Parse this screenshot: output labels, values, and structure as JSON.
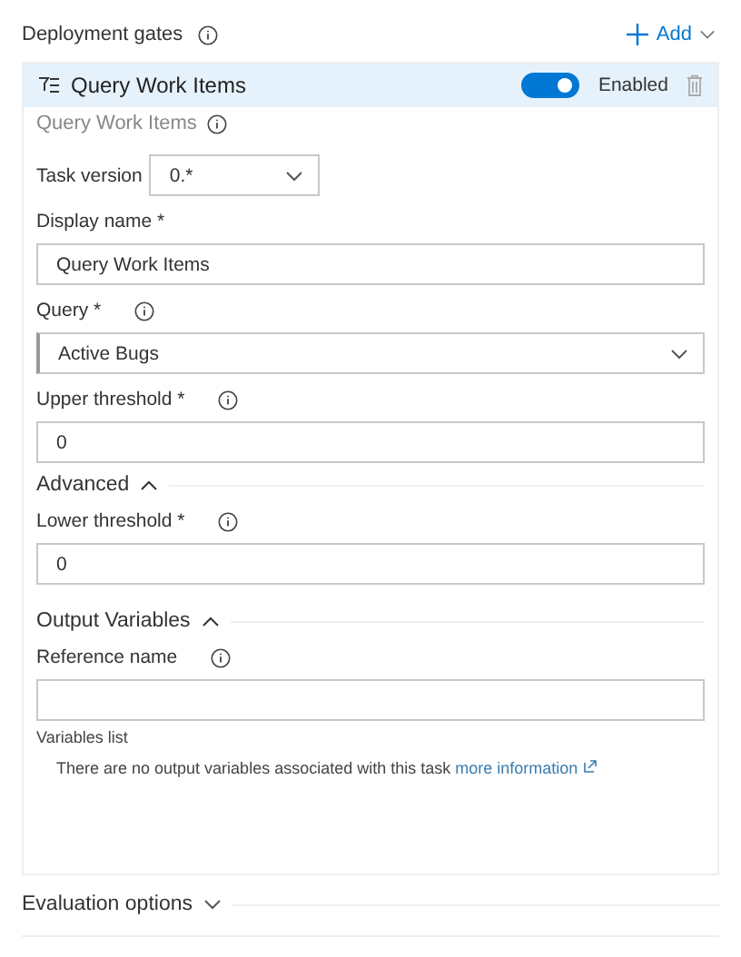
{
  "header": {
    "title": "Deployment gates",
    "add_label": "Add"
  },
  "gate": {
    "name": "Query Work Items",
    "enabled": true,
    "enabled_label": "Enabled",
    "subtitle": "Query Work Items"
  },
  "form": [
    {
      "kind": "inline-select",
      "label": "Task version",
      "value": "0.*",
      "info": false
    },
    {
      "kind": "text",
      "label": "Display name *",
      "value": "Query Work Items",
      "info": false
    },
    {
      "kind": "select",
      "label": "Query *",
      "value": "Active Bugs",
      "info": true
    },
    {
      "kind": "text",
      "label": "Upper threshold *",
      "value": "0",
      "info": true
    },
    {
      "kind": "section",
      "label": "Advanced",
      "expanded": true
    },
    {
      "kind": "text",
      "label": "Lower threshold *",
      "value": "0",
      "info": true
    },
    {
      "kind": "section",
      "label": "Output Variables",
      "expanded": true
    },
    {
      "kind": "text",
      "label": "Reference name",
      "info": true
    },
    {
      "kind": "note",
      "label": "Variables list"
    },
    {
      "kind": "message",
      "text": "There are no output variables associated with this task",
      "link": "more information"
    }
  ],
  "evaluation": {
    "label": "Evaluation options",
    "expanded": false
  }
}
